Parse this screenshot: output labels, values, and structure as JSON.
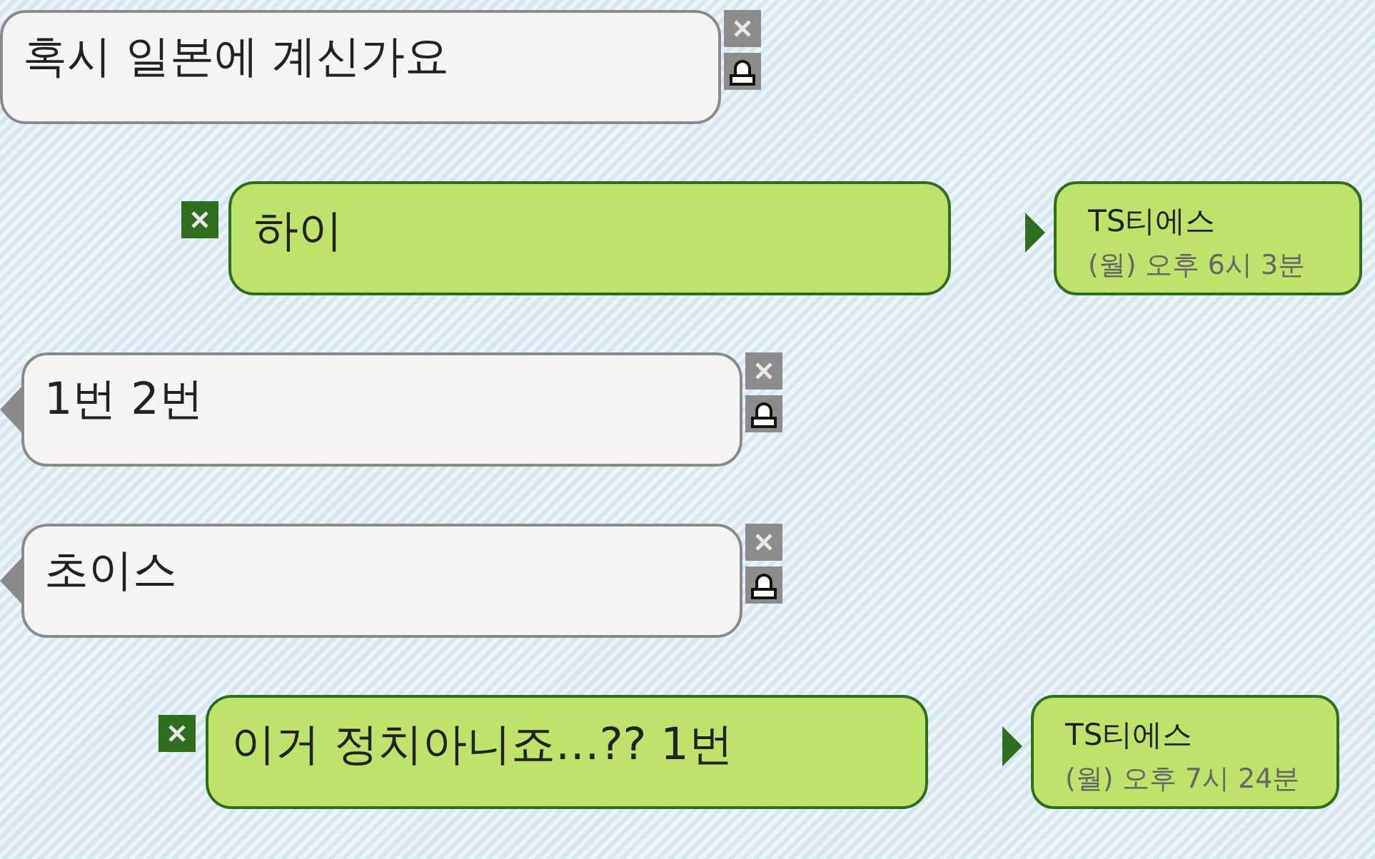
{
  "messages": [
    {
      "kind": "received",
      "text": "혹시 일본에 계신가요",
      "pointer": false
    },
    {
      "kind": "sent",
      "text": "하이",
      "sender": "TS티에스",
      "time": "(월) 오후 6시 3분"
    },
    {
      "kind": "received",
      "text": "1번 2번",
      "pointer": true
    },
    {
      "kind": "received",
      "text": "초이스",
      "pointer": true
    },
    {
      "kind": "sent",
      "text": "이거 정치아니죠…?? 1번",
      "sender": "TS티에스",
      "time": "(월) 오후 7시 24분"
    }
  ]
}
